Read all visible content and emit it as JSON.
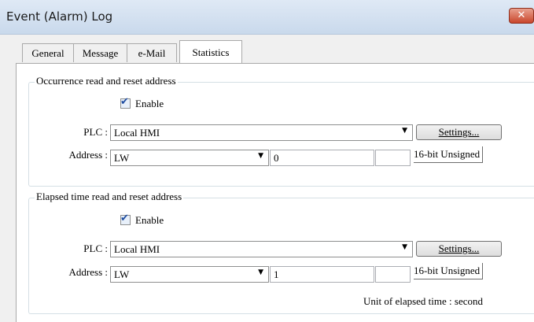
{
  "window": {
    "title": "Event (Alarm) Log",
    "close_label": "✕"
  },
  "tabs": [
    {
      "label": "General"
    },
    {
      "label": "Message"
    },
    {
      "label": "e-Mail"
    },
    {
      "label": "Statistics",
      "active": true
    }
  ],
  "occurrence": {
    "title": "Occurrence read and reset address",
    "enable_label": "Enable",
    "enable_checked": true,
    "plc_label": "PLC :",
    "plc_value": "Local HMI",
    "settings_label": "Settings...",
    "address_label": "Address :",
    "address_device": "LW",
    "address_value": "0",
    "address_extra": "",
    "data_type": "16-bit Unsigned"
  },
  "elapsed": {
    "title": "Elapsed time read and reset address",
    "enable_label": "Enable",
    "enable_checked": true,
    "plc_label": "PLC :",
    "plc_value": "Local HMI",
    "settings_label": "Settings...",
    "address_label": "Address :",
    "address_device": "LW",
    "address_value": "1",
    "address_extra": "",
    "data_type": "16-bit Unsigned",
    "unit_text": "Unit of elapsed time : second"
  },
  "icons": {
    "checkmark": "✔",
    "dropdown": "▼"
  }
}
